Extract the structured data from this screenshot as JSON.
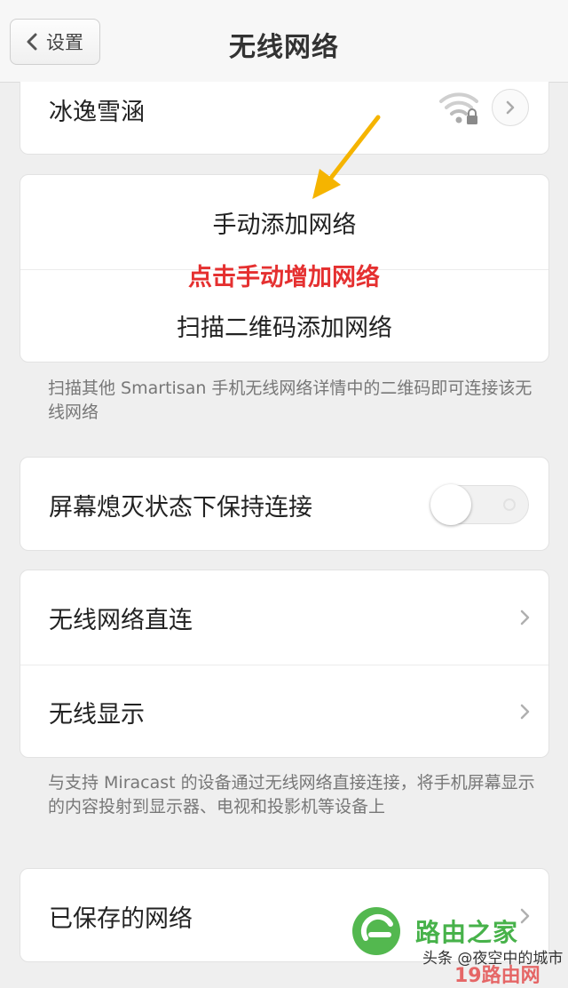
{
  "nav": {
    "back_label": "设置",
    "title": "无线网络"
  },
  "network": {
    "name": "冰逸雪涵",
    "icon": "wifi-lock-icon"
  },
  "add_group": {
    "manual_add": "手动添加网络",
    "qr_add": "扫描二维码添加网络",
    "note": "扫描其他 Smartisan 手机无线网络详情中的二维码即可连接该无线网络"
  },
  "annotation": {
    "text": "点击手动增加网络",
    "color": "#e53030",
    "arrow_color": "#f5b400"
  },
  "keep_alive": {
    "label": "屏幕熄灭状态下保持连接",
    "enabled": false
  },
  "wifi_direct": {
    "direct_label": "无线网络直连",
    "display_label": "无线显示",
    "note": "与支持 Miracast 的设备通过无线网络直接连接，将手机屏幕显示的内容投射到显示器、电视和投影机等设备上"
  },
  "saved": {
    "label": "已保存的网络"
  },
  "watermark": {
    "brand": "路由之家",
    "source": "头条 @夜空中的城市",
    "site": "19路由网"
  }
}
